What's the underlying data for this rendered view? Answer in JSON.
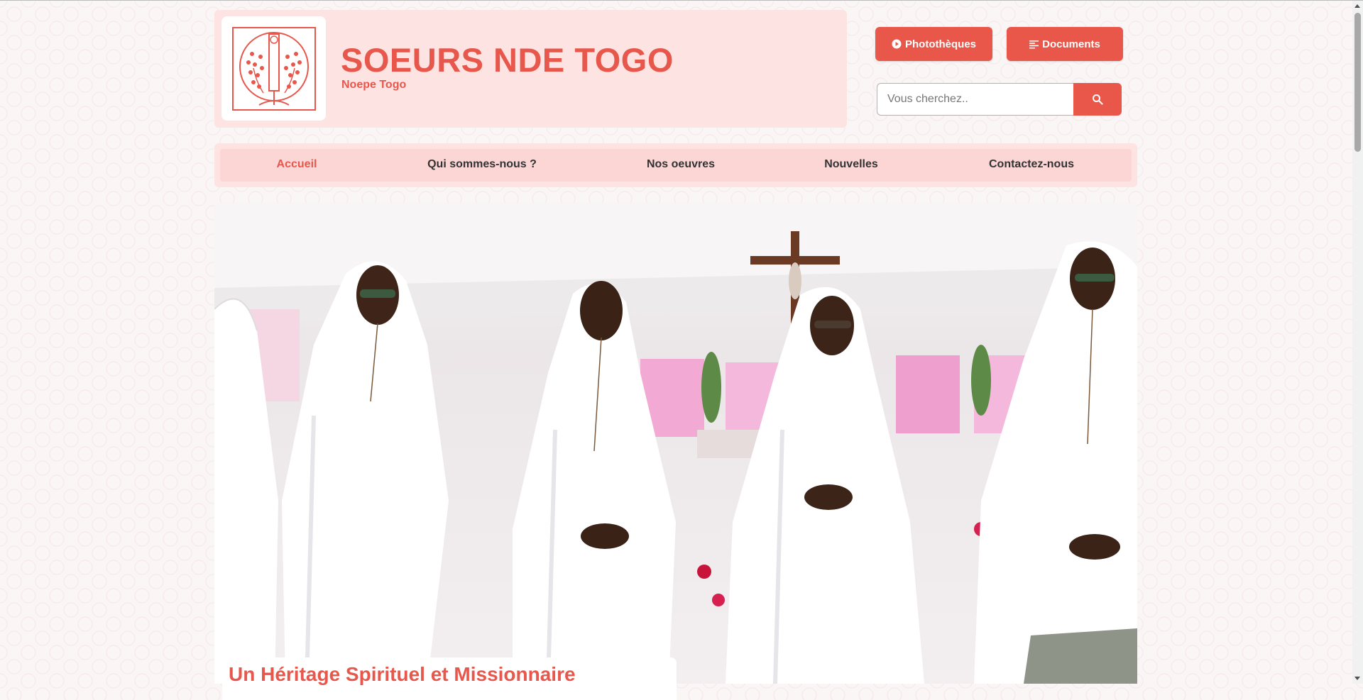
{
  "header": {
    "title": "SOEURS NDE TOGO",
    "subtitle": "Noepe Togo",
    "logo_icon": "nde-emblem-icon"
  },
  "actions": {
    "phototheques_label": "Photothèques",
    "documents_label": "Documents",
    "phototheques_icon": "play-circle-icon",
    "documents_icon": "align-left-icon"
  },
  "search": {
    "placeholder": "Vous cherchez..",
    "value": "",
    "icon": "search-icon"
  },
  "nav": {
    "items": [
      {
        "label": "Accueil",
        "active": true
      },
      {
        "label": "Qui sommes-nous ?",
        "active": false
      },
      {
        "label": "Nos oeuvres",
        "active": false
      },
      {
        "label": "Nouvelles",
        "active": false
      },
      {
        "label": "Contactez-nous",
        "active": false
      }
    ]
  },
  "hero": {
    "caption": "Un Héritage Spirituel et Missionnaire"
  },
  "colors": {
    "accent": "#e8574b",
    "header_bg": "#fde3e2",
    "nav_text": "#333333"
  }
}
